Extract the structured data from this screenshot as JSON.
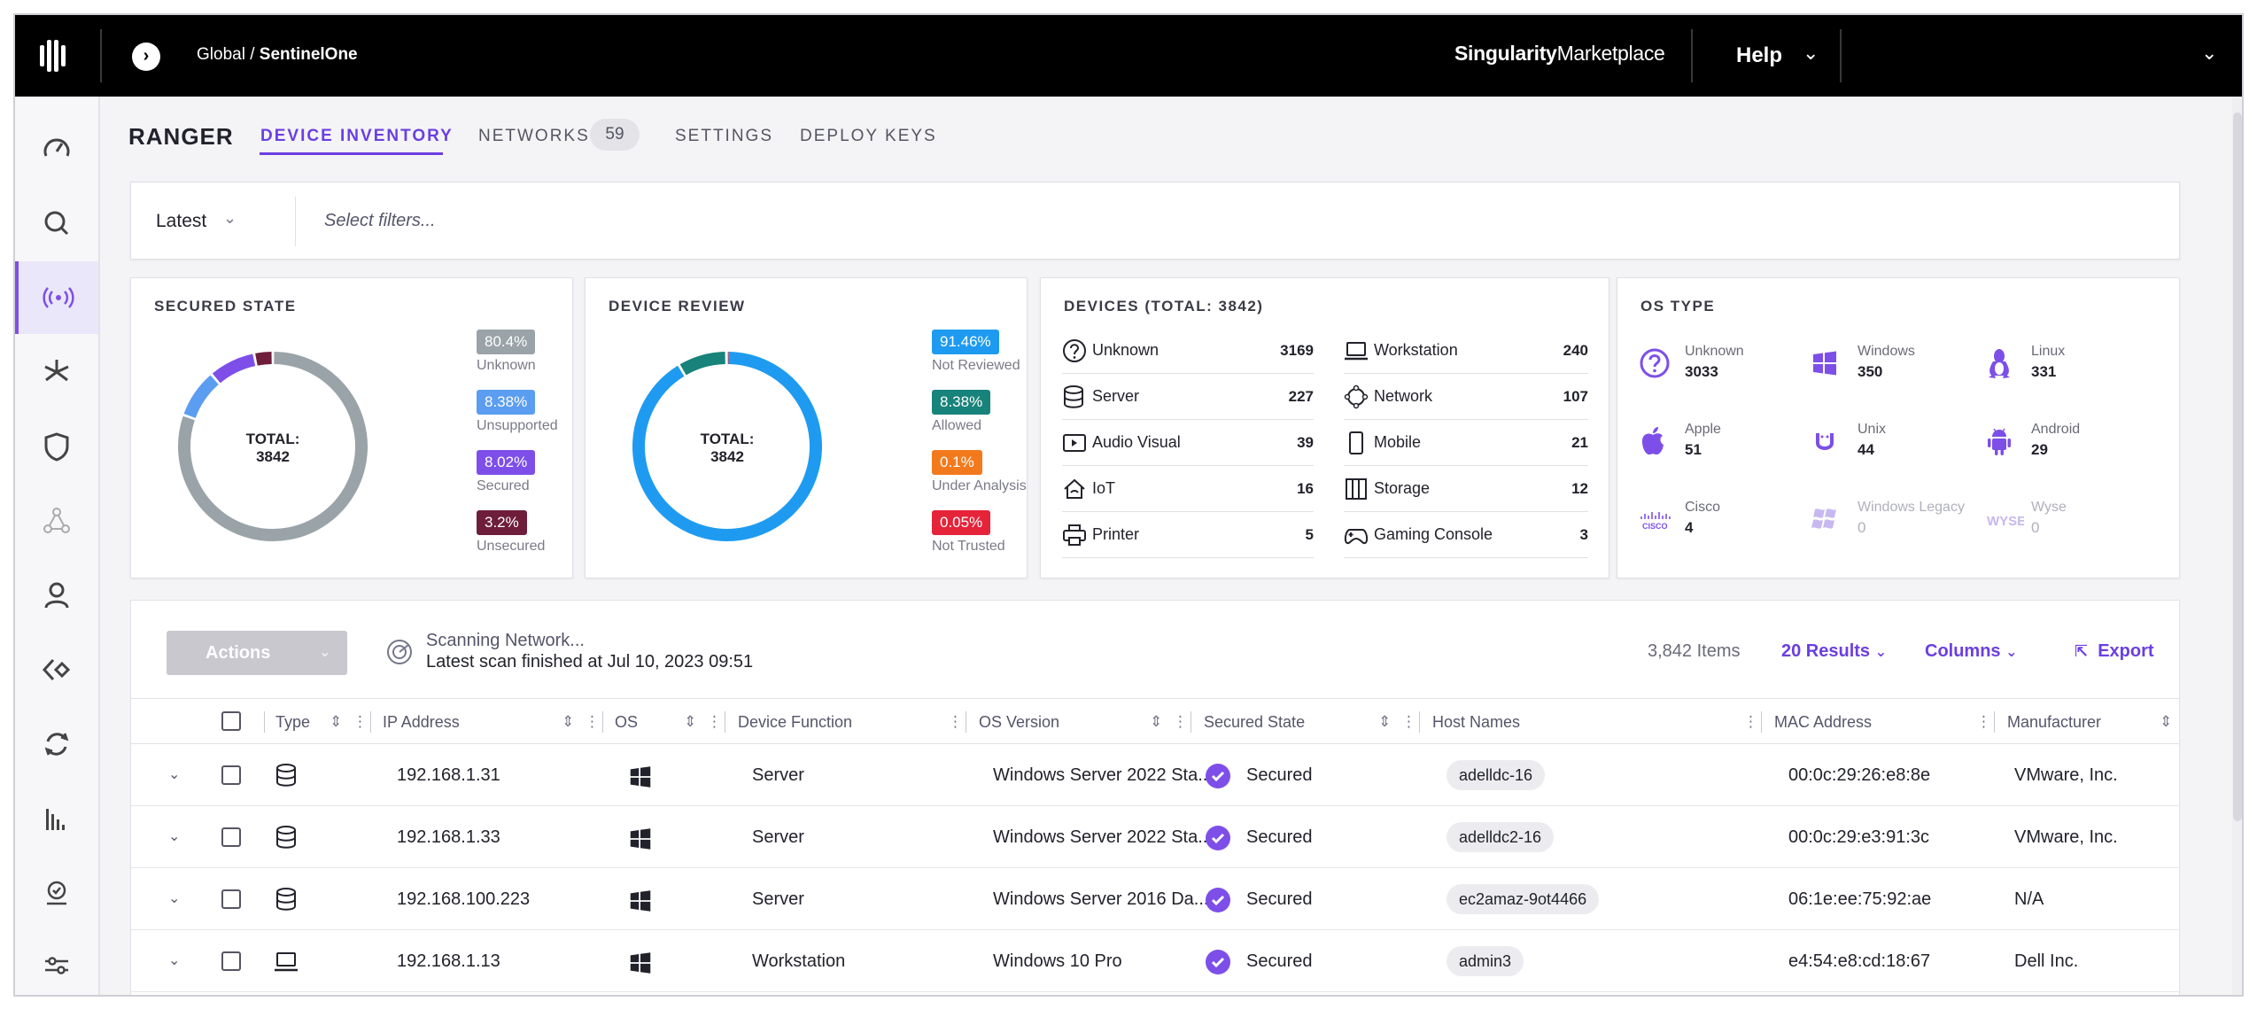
{
  "topbar": {
    "breadcrumb_scope": "Global",
    "breadcrumb_separator": "/",
    "breadcrumb_site": "SentinelOne",
    "marketplace_bold": "Singularity",
    "marketplace_rest": "Marketplace",
    "help_label": "Help"
  },
  "header": {
    "title": "RANGER",
    "tabs": [
      {
        "label": "DEVICE INVENTORY",
        "active": true
      },
      {
        "label": "NETWORKS",
        "badge": "59"
      },
      {
        "label": "SETTINGS"
      },
      {
        "label": "DEPLOY KEYS"
      }
    ]
  },
  "filters": {
    "latest_label": "Latest",
    "placeholder": "Select filters..."
  },
  "secured_state": {
    "title": "SECURED STATE",
    "total_label": "TOTAL:",
    "total": "3842",
    "legend": [
      {
        "value": "80.4%",
        "label": "Unknown",
        "color": "#9aa3a8"
      },
      {
        "value": "8.38%",
        "label": "Unsupported",
        "color": "#5b9df0"
      },
      {
        "value": "8.02%",
        "label": "Secured",
        "color": "#7d4fe8"
      },
      {
        "value": "3.2%",
        "label": "Unsecured",
        "color": "#6e1e3a"
      }
    ]
  },
  "device_review": {
    "title": "DEVICE REVIEW",
    "total_label": "TOTAL:",
    "total": "3842",
    "legend": [
      {
        "value": "91.46%",
        "label": "Not Reviewed",
        "color": "#1e9bf0"
      },
      {
        "value": "8.38%",
        "label": "Allowed",
        "color": "#17837a"
      },
      {
        "value": "0.1%",
        "label": "Under Analysis",
        "color": "#f27a1d"
      },
      {
        "value": "0.05%",
        "label": "Not Trusted",
        "color": "#e5243a"
      }
    ]
  },
  "devices": {
    "title": "DEVICES (TOTAL: 3842)",
    "left": [
      {
        "label": "Unknown",
        "count": "3169",
        "icon": "question-icon"
      },
      {
        "label": "Server",
        "count": "227",
        "icon": "database-icon"
      },
      {
        "label": "Audio Visual",
        "count": "39",
        "icon": "audio-visual-icon"
      },
      {
        "label": "IoT",
        "count": "16",
        "icon": "iot-icon"
      },
      {
        "label": "Printer",
        "count": "5",
        "icon": "printer-icon"
      }
    ],
    "right": [
      {
        "label": "Workstation",
        "count": "240",
        "icon": "laptop-icon"
      },
      {
        "label": "Network",
        "count": "107",
        "icon": "network-icon"
      },
      {
        "label": "Mobile",
        "count": "21",
        "icon": "mobile-icon"
      },
      {
        "label": "Storage",
        "count": "12",
        "icon": "storage-icon"
      },
      {
        "label": "Gaming Console",
        "count": "3",
        "icon": "gamepad-icon"
      }
    ]
  },
  "os_type": {
    "title": "OS TYPE",
    "items": [
      {
        "name": "Unknown",
        "count": "3033",
        "icon": "question-icon"
      },
      {
        "name": "Windows",
        "count": "350",
        "icon": "windows-icon"
      },
      {
        "name": "Linux",
        "count": "331",
        "icon": "linux-icon"
      },
      {
        "name": "Apple",
        "count": "51",
        "icon": "apple-icon"
      },
      {
        "name": "Unix",
        "count": "44",
        "icon": "unix-icon"
      },
      {
        "name": "Android",
        "count": "29",
        "icon": "android-icon"
      },
      {
        "name": "Cisco",
        "count": "4",
        "icon": "cisco-icon"
      },
      {
        "name": "Windows Legacy",
        "count": "0",
        "icon": "windows-legacy-icon"
      },
      {
        "name": "Wyse",
        "count": "0",
        "icon": "wyse-icon"
      }
    ]
  },
  "toolbar": {
    "actions_label": "Actions",
    "scan_title": "Scanning Network...",
    "scan_subtitle": "Latest scan finished at Jul 10, 2023 09:51",
    "items_count": "3,842 Items",
    "results_label": "20 Results",
    "columns_label": "Columns",
    "export_label": "Export"
  },
  "table": {
    "columns": [
      "Type",
      "IP Address",
      "OS",
      "Device Function",
      "OS Version",
      "Secured State",
      "Host Names",
      "MAC Address",
      "Manufacturer"
    ],
    "rows": [
      {
        "type_icon": "database-icon",
        "ip": "192.168.1.31",
        "os_icon": "windows-icon",
        "function": "Server",
        "os_version": "Windows Server 2022 Sta...",
        "secured": "Secured",
        "host": "adelldc-16",
        "mac": "00:0c:29:26:e8:8e",
        "manufacturer": "VMware, Inc."
      },
      {
        "type_icon": "database-icon",
        "ip": "192.168.1.33",
        "os_icon": "windows-icon",
        "function": "Server",
        "os_version": "Windows Server 2022 Sta...",
        "secured": "Secured",
        "host": "adelldc2-16",
        "mac": "00:0c:29:e3:91:3c",
        "manufacturer": "VMware, Inc."
      },
      {
        "type_icon": "database-icon",
        "ip": "192.168.100.223",
        "os_icon": "windows-icon",
        "function": "Server",
        "os_version": "Windows Server 2016 Da...",
        "secured": "Secured",
        "host": "ec2amaz-9ot4466",
        "mac": "06:1e:ee:75:92:ae",
        "manufacturer": "N/A"
      },
      {
        "type_icon": "laptop-icon",
        "ip": "192.168.1.13",
        "os_icon": "windows-icon",
        "function": "Workstation",
        "os_version": "Windows 10 Pro",
        "secured": "Secured",
        "host": "admin3",
        "mac": "e4:54:e8:cd:18:67",
        "manufacturer": "Dell Inc."
      }
    ]
  },
  "colors": {
    "accent": "#6b3fe0",
    "secured_check": "#7d4fe8"
  }
}
